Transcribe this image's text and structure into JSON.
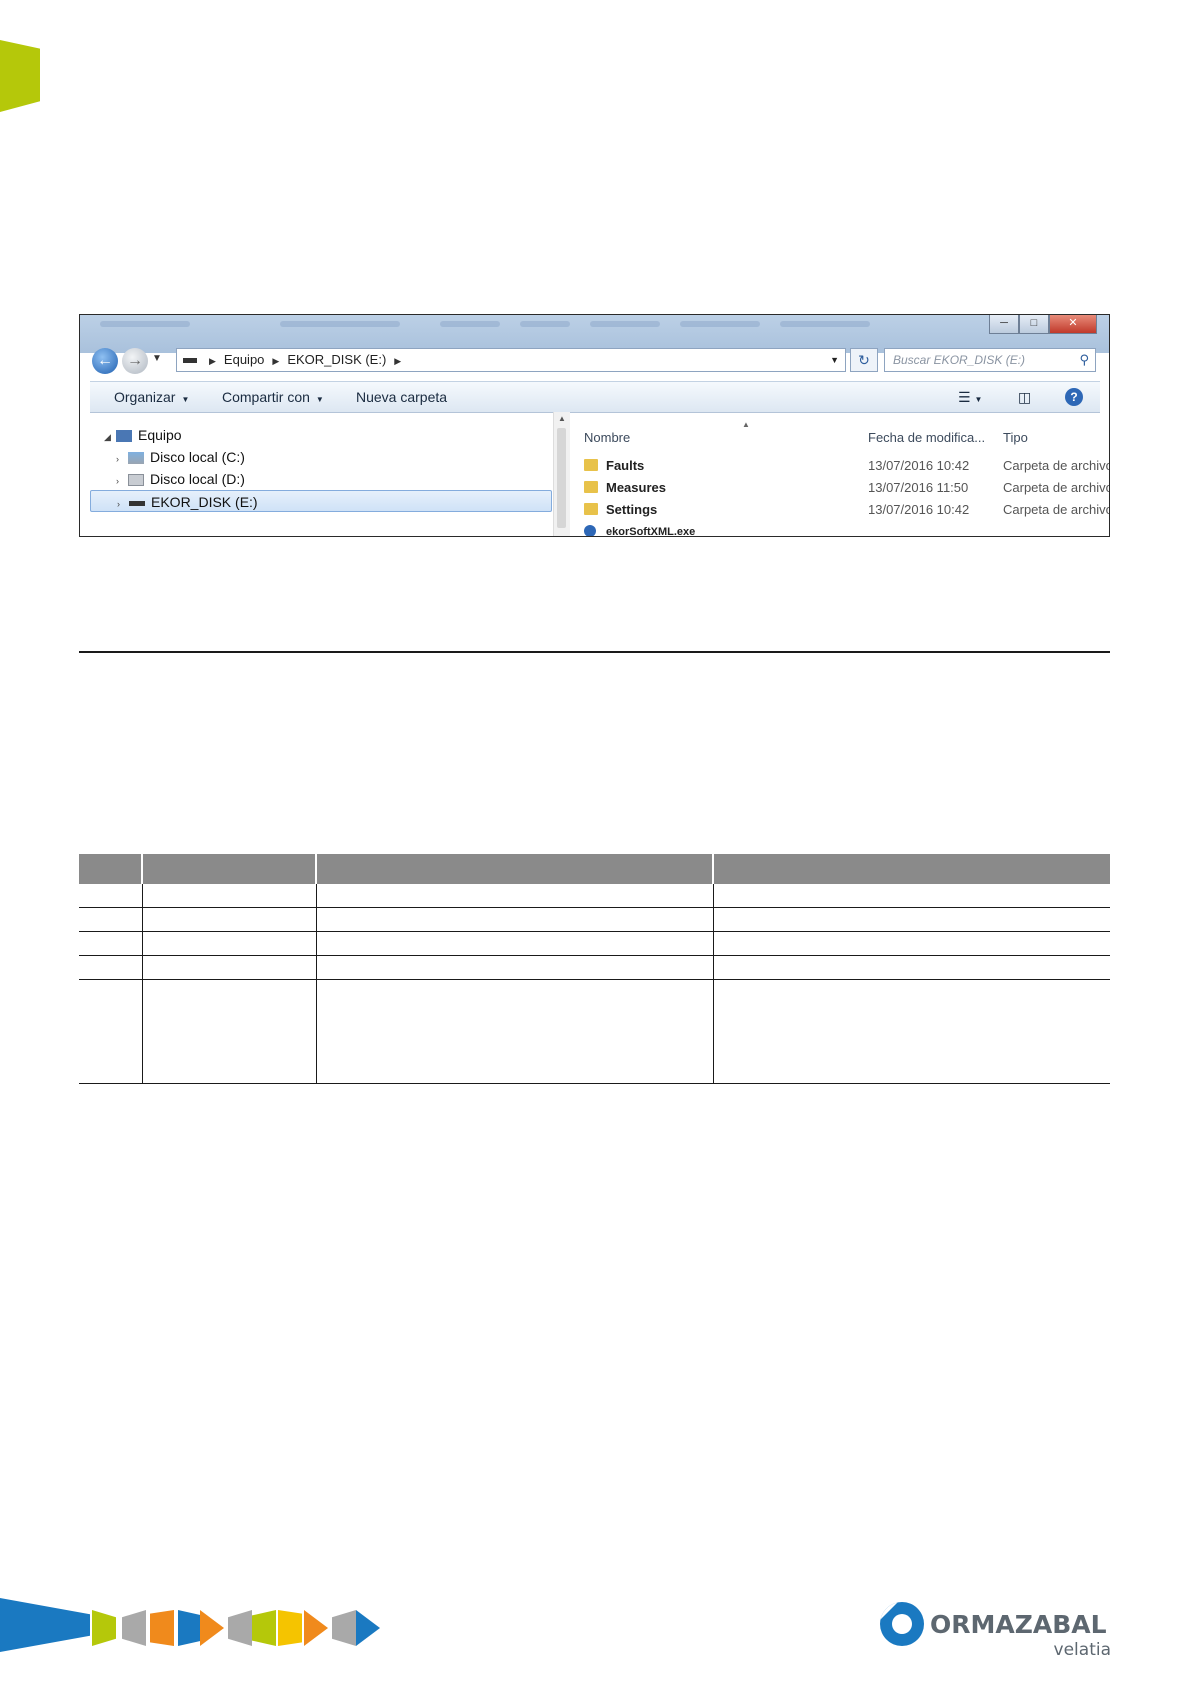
{
  "explorer": {
    "address": {
      "segments": [
        "Equipo",
        "EKOR_DISK (E:)"
      ]
    },
    "search": {
      "placeholder": "Buscar EKOR_DISK (E:)"
    },
    "toolbar": {
      "organize": "Organizar",
      "share": "Compartir con",
      "new_folder": "Nueva carpeta"
    },
    "tree": [
      {
        "label": "Equipo",
        "icon": "computer-icon"
      },
      {
        "label": "Disco local (C:)",
        "icon": "drive-icon"
      },
      {
        "label": "Disco local (D:)",
        "icon": "drive-icon"
      },
      {
        "label": "EKOR_DISK (E:)",
        "icon": "usb-drive-icon",
        "selected": true
      }
    ],
    "columns": {
      "name": "Nombre",
      "date": "Fecha de modifica...",
      "type": "Tipo"
    },
    "files": [
      {
        "name": "Faults",
        "date": "13/07/2016 10:42",
        "type": "Carpeta de archivos",
        "icon": "folder-icon"
      },
      {
        "name": "Measures",
        "date": "13/07/2016 11:50",
        "type": "Carpeta de archivos",
        "icon": "folder-icon"
      },
      {
        "name": "Settings",
        "date": "13/07/2016 10:42",
        "type": "Carpeta de archivos",
        "icon": "folder-icon"
      },
      {
        "name": "ekorSoftXML.exe",
        "date": "",
        "type": "",
        "icon": "app-icon"
      }
    ]
  },
  "table": {
    "headers": [
      "",
      "",
      "",
      ""
    ],
    "rows": [
      [
        "",
        "",
        "",
        ""
      ],
      [
        "",
        "",
        "",
        ""
      ],
      [
        "",
        "",
        "",
        ""
      ],
      [
        "",
        "",
        "",
        ""
      ],
      [
        "",
        "",
        "",
        ""
      ]
    ]
  },
  "footer": {
    "brand": "ORMAZABAL",
    "sub": "velatia",
    "colors": {
      "blue": "#1a79c1",
      "lime": "#b5c80a",
      "orange": "#f08a1c",
      "yellow": "#f5c400",
      "gray": "#a9a9a9"
    }
  }
}
